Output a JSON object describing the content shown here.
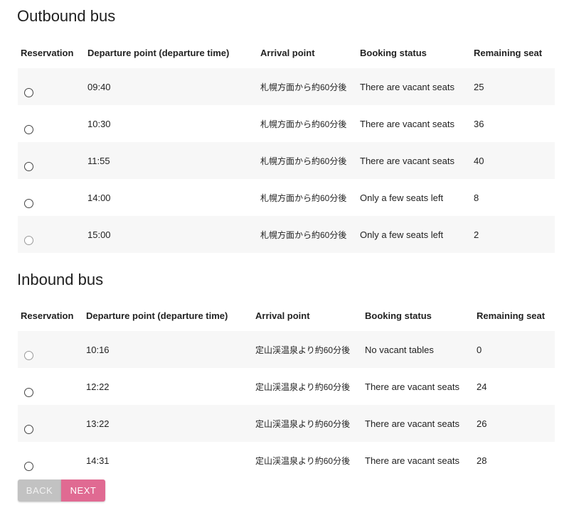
{
  "outbound": {
    "title": "Outbound bus",
    "headers": [
      "Reservation",
      "Departure point (departure time)",
      "Arrival point",
      "Booking status",
      "Remaining seat"
    ],
    "rows": [
      {
        "time": "09:40",
        "arrival": "札幌方面から約60分後",
        "status": "There are vacant seats",
        "seats": "25",
        "enabled": true
      },
      {
        "time": "10:30",
        "arrival": "札幌方面から約60分後",
        "status": "There are vacant seats",
        "seats": "36",
        "enabled": true
      },
      {
        "time": "11:55",
        "arrival": "札幌方面から約60分後",
        "status": "There are vacant seats",
        "seats": "40",
        "enabled": true
      },
      {
        "time": "14:00",
        "arrival": "札幌方面から約60分後",
        "status": "Only a few seats left",
        "seats": "8",
        "enabled": true
      },
      {
        "time": "15:00",
        "arrival": "札幌方面から約60分後",
        "status": "Only a few seats left",
        "seats": "2",
        "enabled": false
      }
    ]
  },
  "inbound": {
    "title": "Inbound bus",
    "headers": [
      "Reservation",
      "Departure point (departure time)",
      "Arrival point",
      "Booking status",
      "Remaining seat"
    ],
    "rows": [
      {
        "time": "10:16",
        "arrival": "定山渓温泉より約60分後",
        "status": "No vacant tables",
        "seats": "0",
        "enabled": false
      },
      {
        "time": "12:22",
        "arrival": "定山渓温泉より約60分後",
        "status": "There are vacant seats",
        "seats": "24",
        "enabled": true
      },
      {
        "time": "13:22",
        "arrival": "定山渓温泉より約60分後",
        "status": "There are vacant seats",
        "seats": "26",
        "enabled": true
      },
      {
        "time": "14:31",
        "arrival": "定山渓温泉より約60分後",
        "status": "There are vacant seats",
        "seats": "28",
        "enabled": true
      }
    ]
  },
  "buttons": {
    "back_label": "BACK",
    "next_label": "NEXT"
  },
  "colors": {
    "next_button": "#e06a92",
    "back_button": "#c2c2c2",
    "row_stripe": "#f7f7f7"
  }
}
